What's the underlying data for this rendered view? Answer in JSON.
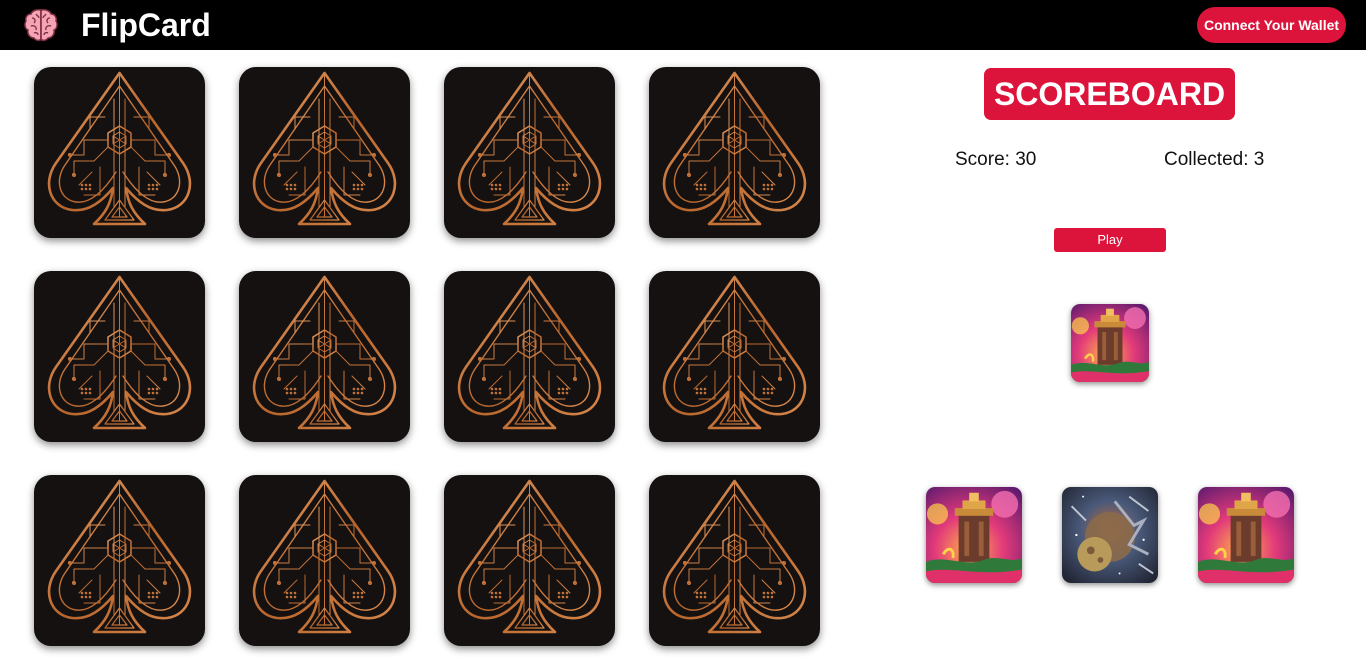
{
  "header": {
    "logo_icon": "brain-icon",
    "app_title": "FlipCard",
    "wallet_button_label": "Connect Your Wallet",
    "accent_color": "#dc143c"
  },
  "board": {
    "card_back_icon": "spade-card-back-icon",
    "rows": 3,
    "columns": 4,
    "card_count": 12
  },
  "scoreboard": {
    "title": "SCOREBOARD",
    "score_text": "Score: 30",
    "collected_text": "Collected: 3",
    "play_label": "Play",
    "current_card": "temple-art-card",
    "collected_cards": [
      "temple-art-card",
      "space-planet-art-card",
      "temple-art-card"
    ]
  }
}
